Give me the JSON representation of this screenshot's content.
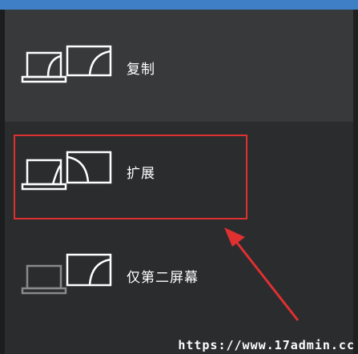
{
  "options": [
    {
      "label": "复制",
      "icon": "duplicate-display-icon"
    },
    {
      "label": "扩展",
      "icon": "extend-display-icon"
    },
    {
      "label": "仅第二屏幕",
      "icon": "second-screen-only-icon"
    }
  ],
  "annotation": {
    "box_color": "#e03030",
    "arrow_color": "#e03030"
  },
  "watermark": "https://www.17admin.cc",
  "colors": {
    "accent_strip": "#3f7fc6",
    "panel_bg": "#2a2c2e",
    "selected_bg": "#37393b",
    "icon_active": "#ffffff",
    "icon_inactive": "#8a8a8a"
  }
}
